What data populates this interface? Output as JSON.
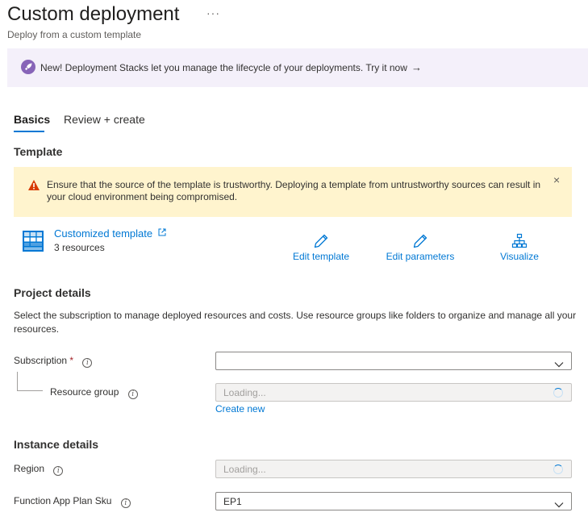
{
  "header": {
    "title": "Custom deployment",
    "more_label": "···",
    "subtitle": "Deploy from a custom template"
  },
  "banner": {
    "text": "New! Deployment Stacks let you manage the lifecycle of your deployments. Try it now",
    "arrow": "→",
    "icon": "rocket-icon"
  },
  "tabs": [
    {
      "label": "Basics",
      "active": true
    },
    {
      "label": "Review + create",
      "active": false
    }
  ],
  "template_section": {
    "heading": "Template",
    "warning": {
      "text": "Ensure that the source of the template is trustworthy. Deploying a template from untrustworthy sources can result in your cloud environment being compromised.",
      "close": "×"
    },
    "template": {
      "link": "Customized template",
      "resources": "3 resources"
    },
    "actions": [
      {
        "label": "Edit template",
        "icon": "pencil-icon"
      },
      {
        "label": "Edit parameters",
        "icon": "pencil-icon"
      },
      {
        "label": "Visualize",
        "icon": "hierarchy-icon"
      }
    ]
  },
  "project_details": {
    "heading": "Project details",
    "description": "Select the subscription to manage deployed resources and costs. Use resource groups like folders to organize and manage all your resources.",
    "subscription": {
      "label": "Subscription",
      "required_mark": "*",
      "value": ""
    },
    "resource_group": {
      "label": "Resource group",
      "value": "Loading..."
    },
    "create_new": "Create new"
  },
  "instance_details": {
    "heading": "Instance details",
    "region": {
      "label": "Region",
      "value": "Loading..."
    },
    "plan_sku": {
      "label": "Function App Plan Sku",
      "value": "EP1"
    }
  },
  "colors": {
    "accent": "#0078d4",
    "banner_bg": "#f4f0fa",
    "warning_bg": "#fff4ce",
    "warning_icon": "#d83b01",
    "required": "#a4262c"
  }
}
